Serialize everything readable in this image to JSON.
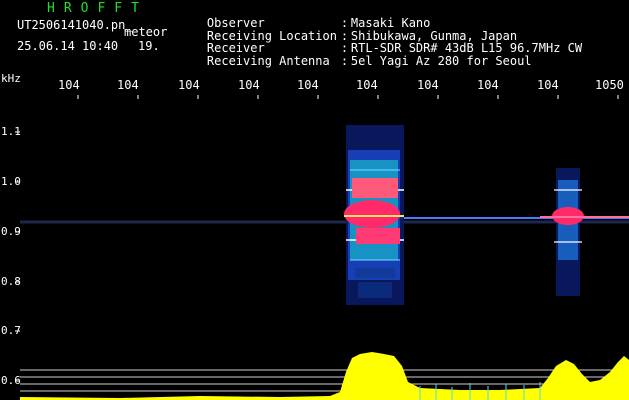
{
  "header": {
    "brand": "HROFFT",
    "file": "UT2506141040.pn_",
    "type": "meteor",
    "datetime": "25.06.14 10:40",
    "count": "19."
  },
  "meta": [
    {
      "label": "Observer",
      "value": "Masaki Kano"
    },
    {
      "label": "Receiving Location",
      "value": "Shibukawa, Gunma, Japan"
    },
    {
      "label": "Receiver",
      "value": "RTL-SDR SDR# 43dB L15 96.7MHz CW"
    },
    {
      "label": "Receiving Antenna",
      "value": "5el Yagi Az 280 for Seoul"
    }
  ],
  "meta_sep": ":",
  "axis": {
    "y_unit": "kHz",
    "x_ticks": [
      "104",
      "104",
      "104",
      "104",
      "104",
      "104",
      "104",
      "104",
      "104",
      "1050"
    ],
    "y_ticks": [
      "1.1",
      "1.0",
      "0.9",
      "0.8",
      "0.7",
      "0.6"
    ]
  },
  "colors": {
    "brand": "#22e02a",
    "echo_core": "#ff2a6a",
    "level": "#ffff00",
    "background": "#000000"
  }
}
